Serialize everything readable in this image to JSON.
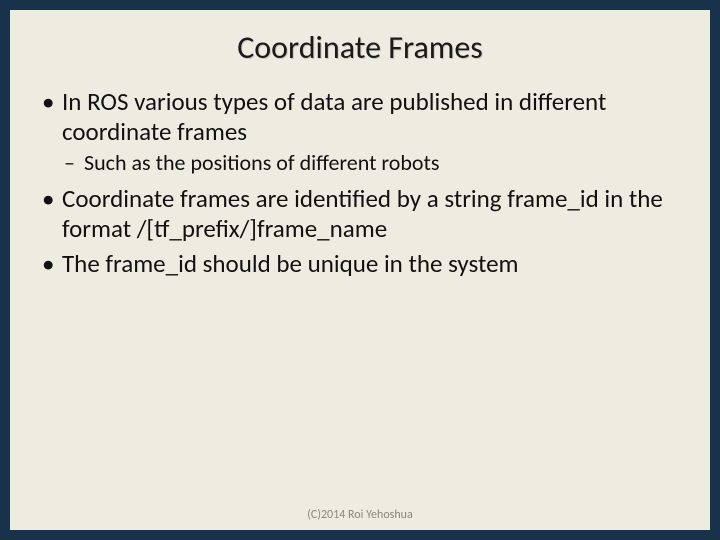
{
  "title": "Coordinate Frames",
  "bullets": {
    "b1": "In ROS various types of data are published in different coordinate frames",
    "b1_sub1": "Such as the positions of different robots",
    "b2": "Coordinate frames are identified by a string frame_id in the format /[tf_prefix/]frame_name",
    "b3": "The frame_id should be unique in the system"
  },
  "footer": "(C)2014 Roi Yehoshua"
}
